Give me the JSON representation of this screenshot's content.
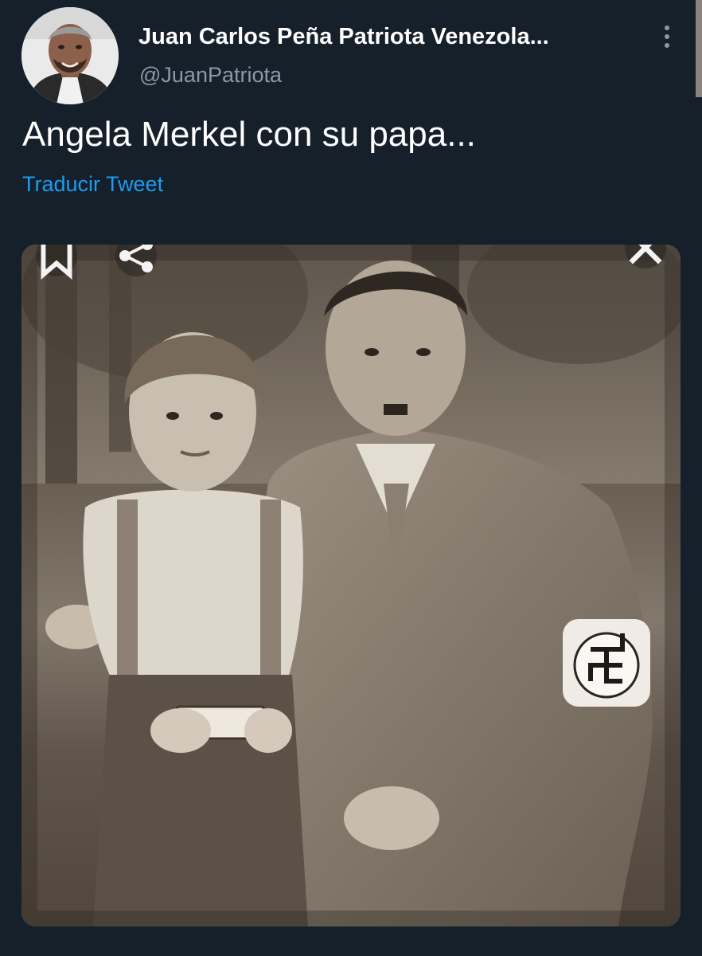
{
  "tweet": {
    "author": {
      "display_name": "Juan Carlos Peña Patriota Venezola...",
      "handle": "@JuanPatriota",
      "avatar_icon": "user-avatar"
    },
    "text": "Angela Merkel con su papa...",
    "translate_label": "Traducir Tweet",
    "more_icon": "more-vertical-icon",
    "media": {
      "kind": "photo",
      "tone": "sepia",
      "overlay_icons": [
        "bookmark-icon",
        "share-icon",
        "close-icon"
      ]
    }
  },
  "colors": {
    "background": "#15202b",
    "text_primary": "#ffffff",
    "text_secondary": "#8b98a5",
    "link": "#1d9bf0"
  }
}
